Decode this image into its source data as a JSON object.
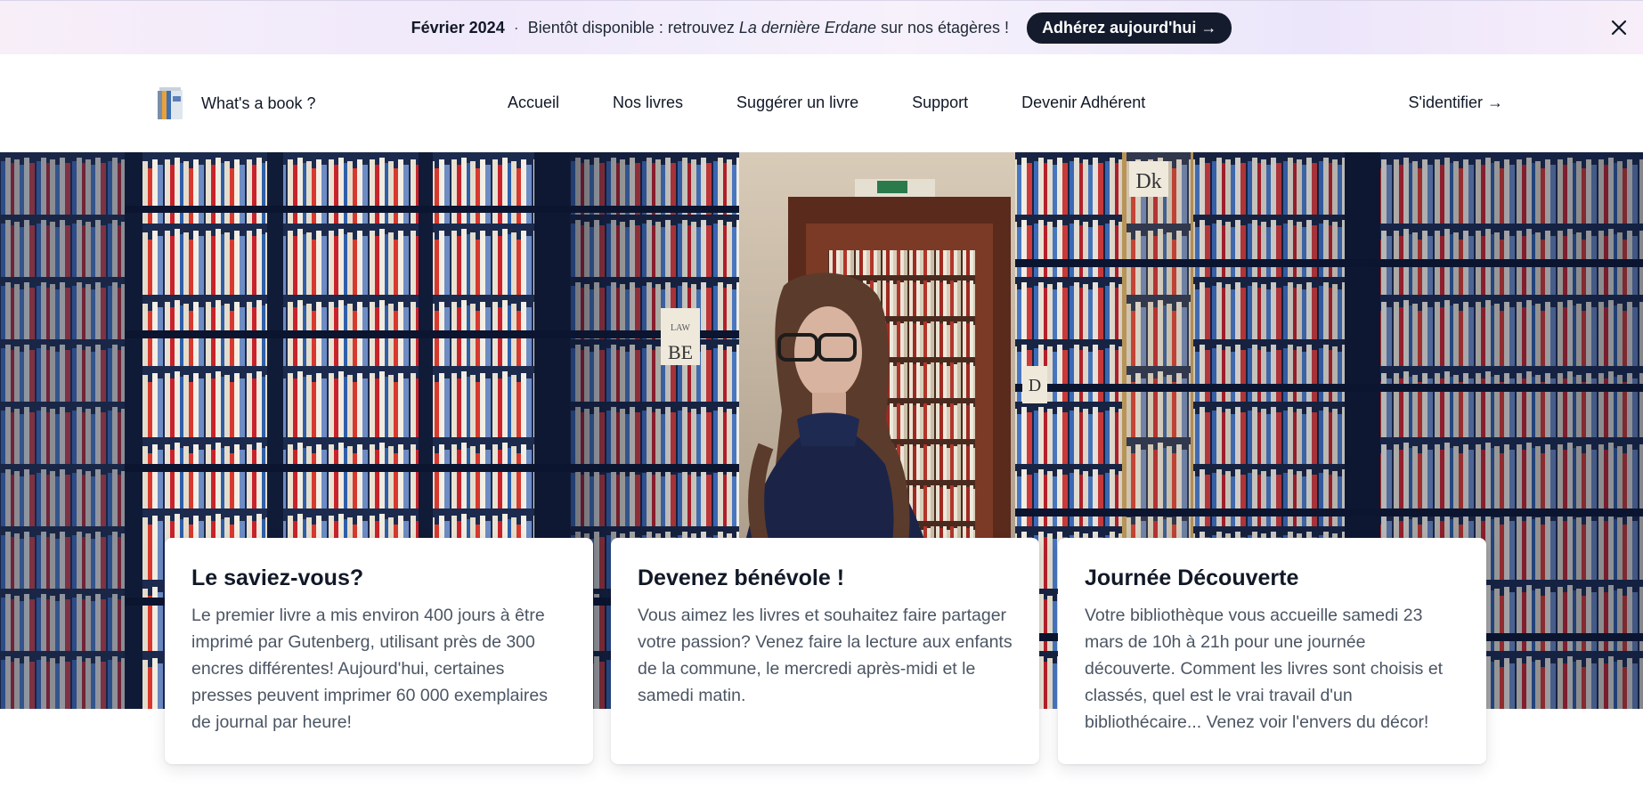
{
  "banner": {
    "date": "Février 2024",
    "separator": "·",
    "text_before": "Bientôt disponible : retrouvez ",
    "text_title": "La dernière Erdane",
    "text_after": " sur nos étagères !",
    "cta_label": "Adhérez aujourd'hui →",
    "close_icon": "close-icon"
  },
  "header": {
    "brand_name": "What's a book ?",
    "logo_icon": "book-logo-icon",
    "nav": [
      {
        "label": "Accueil"
      },
      {
        "label": "Nos livres"
      },
      {
        "label": "Suggérer un livre"
      },
      {
        "label": "Support"
      },
      {
        "label": "Devenir Adhérent"
      }
    ],
    "login_label": "S'identifier →"
  },
  "hero": {
    "image_description_icon": "library-hero-image",
    "shelf_signs": [
      "Dk",
      "LAW",
      "BE",
      "D"
    ]
  },
  "cards": [
    {
      "title": "Le saviez-vous?",
      "body": "Le premier livre a mis environ 400 jours à être imprimé par Gutenberg, utilisant près de 300 encres différentes! Aujourd'hui, certaines presses peuvent imprimer 60 000 exemplaires de journal par heure!"
    },
    {
      "title": "Devenez bénévole !",
      "body": "Vous aimez les livres et souhaitez faire partager votre passion? Venez faire la lecture aux enfants de la commune, le mercredi après-midi et le samedi matin."
    },
    {
      "title": "Journée Découverte",
      "body": "Votre bibliothèque vous accueille samedi 23 mars de 10h à 21h pour une journée découverte. Comment les livres sont choisis et classés, quel est le vrai travail d'un bibliothécaire... Venez voir l'envers du décor!"
    }
  ],
  "colors": {
    "banner_cta_bg": "#141b2d",
    "text_primary": "#111827",
    "text_body": "#4b5563"
  }
}
